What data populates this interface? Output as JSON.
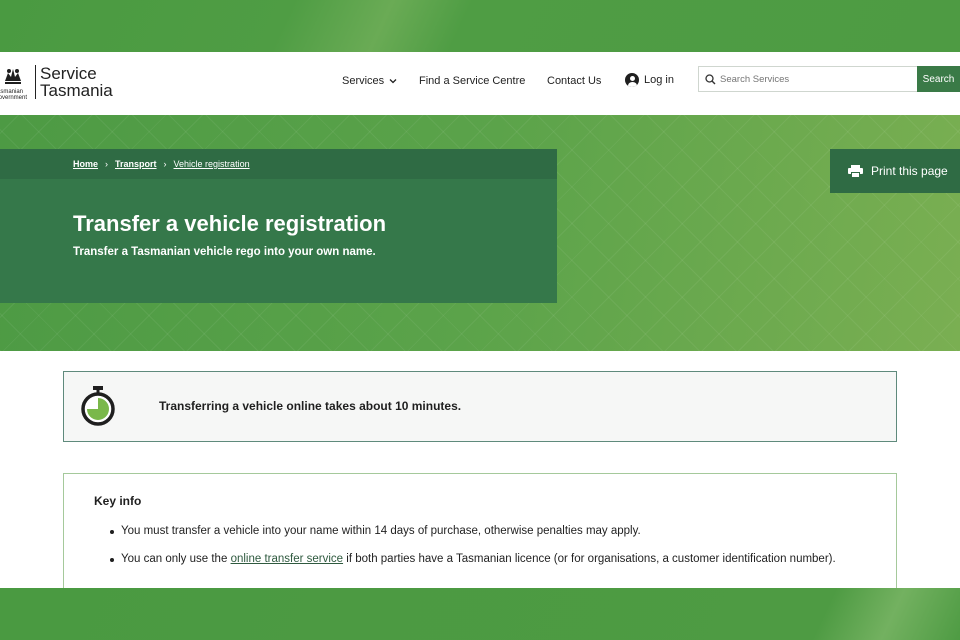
{
  "header": {
    "logo_top": "Service",
    "logo_bottom": "Tasmania",
    "logo_gov": "Tasmanian Government",
    "nav": {
      "services": "Services",
      "find_centre": "Find a Service Centre",
      "contact": "Contact Us",
      "login": "Log in"
    },
    "search": {
      "placeholder": "Search Services",
      "button": "Search"
    }
  },
  "breadcrumb": [
    "Home",
    "Transport",
    "Vehicle registration"
  ],
  "hero": {
    "title": "Transfer a vehicle registration",
    "subtitle": "Transfer a Tasmanian vehicle rego into your own name."
  },
  "print_label": "Print this page",
  "time_notice": "Transferring a vehicle online takes about 10 minutes.",
  "key_info": {
    "title": "Key info",
    "item1": "You must transfer a vehicle into your name within 14 days of purchase, otherwise penalties may apply.",
    "item2_before": "You can only use the ",
    "item2_link": "online transfer service",
    "item2_after": " if both parties have a Tasmanian licence (or for organisations, a customer identification number)."
  },
  "colors": {
    "brand_green": "#35784a",
    "dark_green": "#2f6b44",
    "search_button": "#3a7a47",
    "background_green": "#4f9a42"
  },
  "icons": [
    "tasmanian-government-logo-icon",
    "chevron-down-icon",
    "user-icon",
    "search-icon",
    "printer-icon",
    "stopwatch-icon"
  ]
}
